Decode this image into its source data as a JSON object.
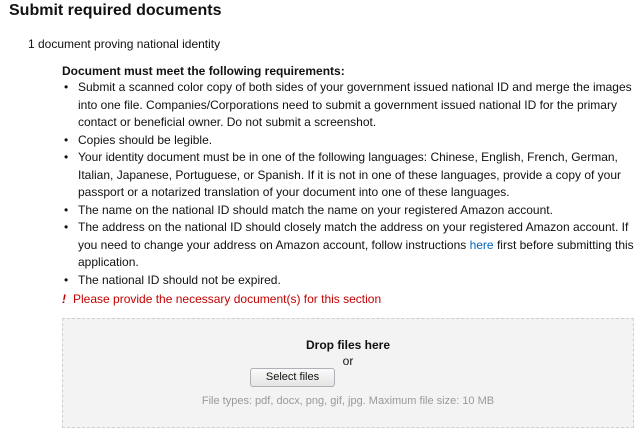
{
  "page": {
    "title": "Submit required documents",
    "subtitle": "1 document proving national identity"
  },
  "requirements": {
    "heading": "Document must meet the following requirements:",
    "bullet": "•",
    "items": [
      {
        "text": "Submit a scanned color copy of both sides of your government issued national ID and merge the images into one file. Companies/Corporations need to submit a government issued national ID for the primary contact or beneficial owner. Do not submit a screenshot."
      },
      {
        "text": "Copies should be legible."
      },
      {
        "text": "Your identity document must be in one of the following languages: Chinese, English, French, German, Italian, Japanese, Portuguese, or Spanish. If it is not in one of these languages, provide a copy of your passport or a notarized translation of your document into one of these languages."
      },
      {
        "text": "The name on the national ID should match the name on your registered Amazon account."
      },
      {
        "text_before": "The address on the national ID should closely match the address on your registered Amazon account. If you need to change your address on Amazon account, follow instructions ",
        "link": "here",
        "text_after": " first before submitting this application."
      },
      {
        "text": "The national ID should not be expired."
      }
    ]
  },
  "error": {
    "icon": "!",
    "message": "Please provide the necessary document(s) for this section"
  },
  "dropzone": {
    "title": "Drop files here",
    "or": "or",
    "button_label": "Select files",
    "file_types": "File types: pdf, docx, png, gif, jpg. Maximum file size: 10 MB"
  },
  "colors": {
    "link": "#0066c0",
    "error": "#c40000",
    "dropzone_bg": "#f3f3f3"
  }
}
